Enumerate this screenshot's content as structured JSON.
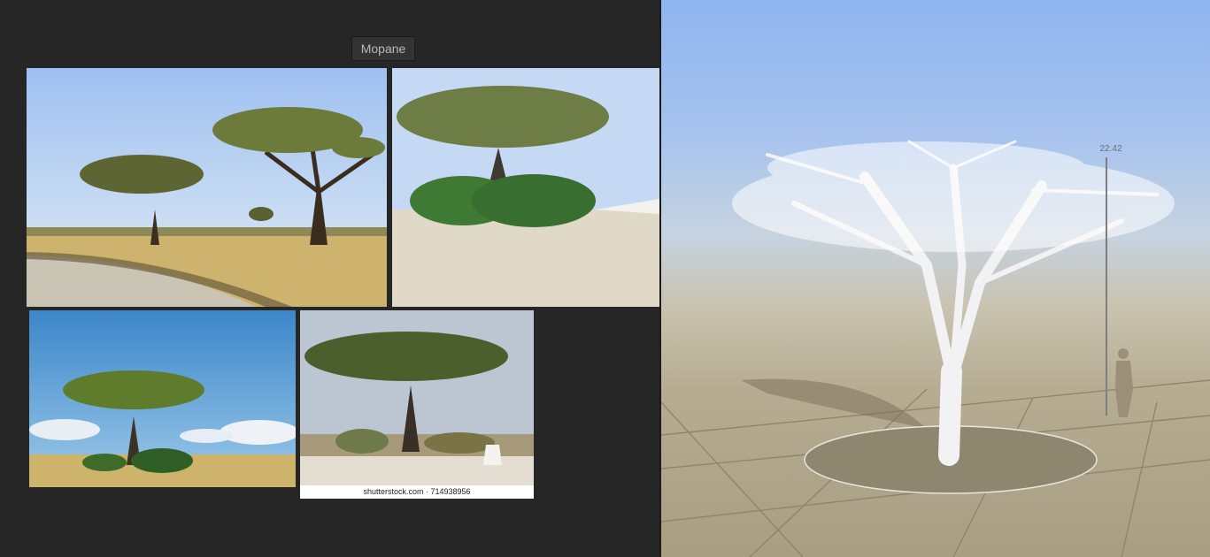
{
  "reference_board": {
    "title": "Mopane",
    "photos": [
      {
        "subject": "two acacia trees by gravel road in savanna"
      },
      {
        "subject": "umbrella acacia behind green bushes in dry grass"
      },
      {
        "subject": "flat-topped acacia under blue sky with clouds"
      },
      {
        "subject": "acacia tree with marker stone",
        "caption": "shutterstock.com · 714938956"
      }
    ]
  },
  "viewport": {
    "height_readout": "22.42",
    "sky_color": "#8fb4ef",
    "ground_color": "#a89e82",
    "tree_color": "#f2f2f4"
  }
}
